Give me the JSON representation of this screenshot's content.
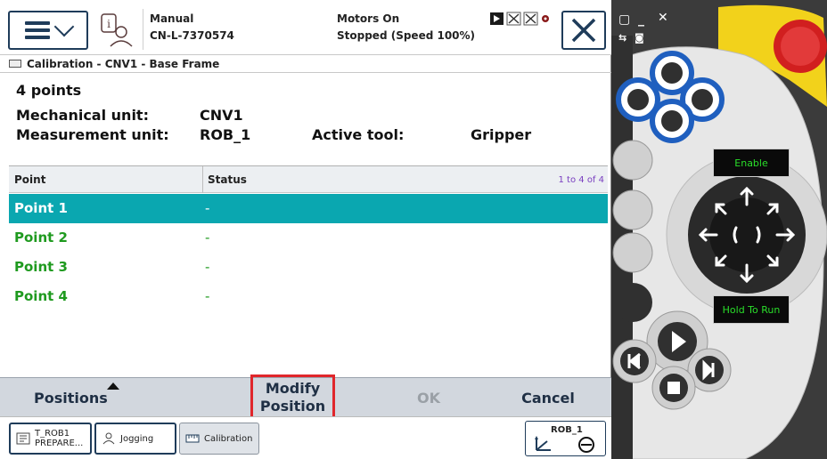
{
  "header": {
    "mode": "Manual",
    "controller": "CN-L-7370574",
    "motors": "Motors On",
    "state": "Stopped (Speed 100%)"
  },
  "window_title": "Calibration - CNV1 - Base Frame",
  "info": {
    "points_count": "4 points",
    "mech_label": "Mechanical unit:",
    "mech_value": "CNV1",
    "meas_label": "Measurement unit:",
    "meas_value": "ROB_1",
    "tool_label": "Active tool:",
    "tool_value": "Gripper"
  },
  "table": {
    "columns": [
      "Point",
      "Status"
    ],
    "range": "1 to 4 of 4",
    "rows": [
      {
        "point": "Point 1",
        "status": "-"
      },
      {
        "point": "Point 2",
        "status": "-"
      },
      {
        "point": "Point 3",
        "status": "-"
      },
      {
        "point": "Point 4",
        "status": "-"
      }
    ],
    "selected_index": 0
  },
  "commands": {
    "positions": "Positions",
    "modify_line1": "Modify",
    "modify_line2": "Position",
    "ok": "OK",
    "cancel": "Cancel"
  },
  "taskbar": {
    "task1_line1": "T_ROB1",
    "task1_line2": "PREPARE...",
    "task2": "Jogging",
    "task3": "Calibration",
    "quickset_unit": "ROB_1"
  },
  "pendant": {
    "enable": "Enable",
    "hold_to_run": "Hold To Run"
  },
  "colors": {
    "selected_row": "#0aa7b0",
    "point_text": "#1f9a1f",
    "highlight_box": "#e0262b",
    "pendant_yellow": "#f2d21b",
    "pendant_blue": "#1f5fbf"
  }
}
